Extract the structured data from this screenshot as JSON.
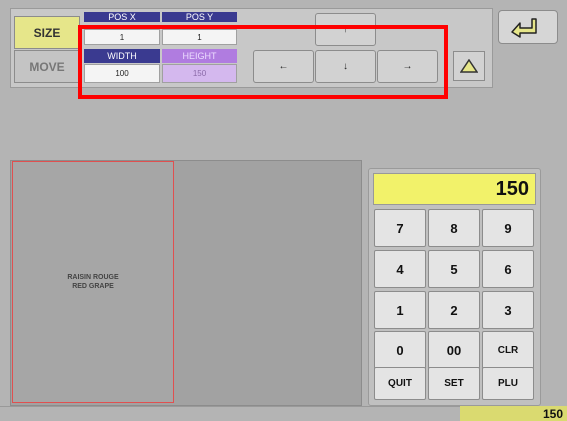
{
  "mode_buttons": {
    "size": "SIZE",
    "move": "MOVE"
  },
  "position": {
    "x_label": "POS X",
    "y_label": "POS Y",
    "x_value": "1",
    "y_value": "1"
  },
  "dimensions": {
    "width_label": "WIDTH",
    "height_label": "HEIGHT",
    "width_value": "100",
    "height_value": "150"
  },
  "arrows": {
    "up": "↑",
    "left": "←",
    "down": "↓",
    "right": "→"
  },
  "icons": {
    "triangle": "triangle-up-icon",
    "back": "return-arrow-icon"
  },
  "item": {
    "line1": "RAISIN ROUGE",
    "line2": "RED GRAPE"
  },
  "keypad": {
    "display": "150",
    "keys": [
      "7",
      "8",
      "9",
      "4",
      "5",
      "6",
      "1",
      "2",
      "3",
      "0",
      "00",
      "CLR",
      "QUIT",
      "SET",
      "PLU"
    ]
  },
  "status": {
    "value": "150"
  },
  "colors": {
    "active": "#e6e68a",
    "display": "#f2f26a",
    "highlight": "#ff0000",
    "width_header": "#3a3a90",
    "height_header": "#b07ce0"
  }
}
